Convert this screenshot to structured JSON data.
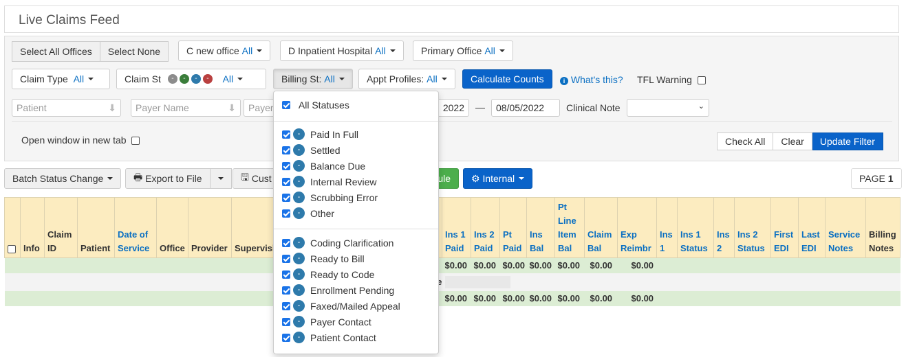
{
  "title": "Live Claims Feed",
  "office": {
    "select_all": "Select All Offices",
    "select_none": "Select None",
    "filters": [
      {
        "label": "C new office",
        "value": "All"
      },
      {
        "label": "D Inpatient Hospital",
        "value": "All"
      },
      {
        "label": "Primary Office",
        "value": "All"
      }
    ]
  },
  "filters": {
    "claim_type": {
      "label": "Claim Type",
      "value": "All"
    },
    "claim_st": {
      "label": "Claim St",
      "value": "All",
      "dot": "-",
      "dot_colors": [
        "#8c8c8c",
        "#3a7d3a",
        "#2e7aab",
        "#b94040"
      ]
    },
    "billing_st": {
      "label": "Billing St:",
      "value": "All"
    },
    "appt_profiles": {
      "label": "Appt Profiles:",
      "value": "All"
    },
    "calculate": "Calculate Counts",
    "whats_this": "What's this?",
    "tfl_warning": "TFL Warning"
  },
  "inputs": {
    "patient_placeholder": "Patient",
    "payer_name_placeholder": "Payer Name",
    "payer_placeholder": "Payer",
    "date_from": "2022",
    "date_sep": "—",
    "date_to": "08/05/2022",
    "clinical_note": "Clinical Note"
  },
  "open_new_tab": "Open window in new tab",
  "actions": {
    "check_all": "Check All",
    "clear": "Clear",
    "update_filter": "Update Filter"
  },
  "toolbar": {
    "batch": "Batch Status Change",
    "export": "Export to File",
    "custom": "Cust",
    "schedule": "ule",
    "internal": "Internal",
    "page_label": "PAGE",
    "page_num": "1"
  },
  "dropdown": {
    "all": "All Statuses",
    "group1": [
      "Paid In Full",
      "Settled",
      "Balance Due",
      "Internal Review",
      "Scrubbing Error",
      "Other"
    ],
    "group2": [
      "Coding Clarification",
      "Ready to Bill",
      "Ready to Code",
      "Enrollment Pending",
      "Faxed/Mailed Appeal",
      "Payer Contact",
      "Patient Contact"
    ],
    "dot": "-"
  },
  "table": {
    "headers": [
      "Info",
      "Claim ID",
      "Patient",
      "Date of Service",
      "Office",
      "Provider",
      "Supervising Provider",
      "",
      "Ins 1 Paid",
      "Ins 2 Paid",
      "Pt Paid",
      "Ins Bal",
      "Pt Line Item Bal",
      "Claim Bal",
      "Exp Reimbr",
      "Ins 1",
      "Ins 1 Status",
      "Ins 2",
      "Ins 2 Status",
      "First EDI",
      "Last EDI",
      "Service Notes",
      "Billing Notes"
    ],
    "row1": [
      "$0.00",
      "$0.00",
      "$0.00",
      "$0.00",
      "$0.00",
      "$0.00",
      "$0.00"
    ],
    "row2_fragment": "e",
    "row3": [
      "$0.00",
      "$0.00",
      "$0.00",
      "$0.00",
      "$0.00",
      "$0.00",
      "$0.00"
    ]
  }
}
